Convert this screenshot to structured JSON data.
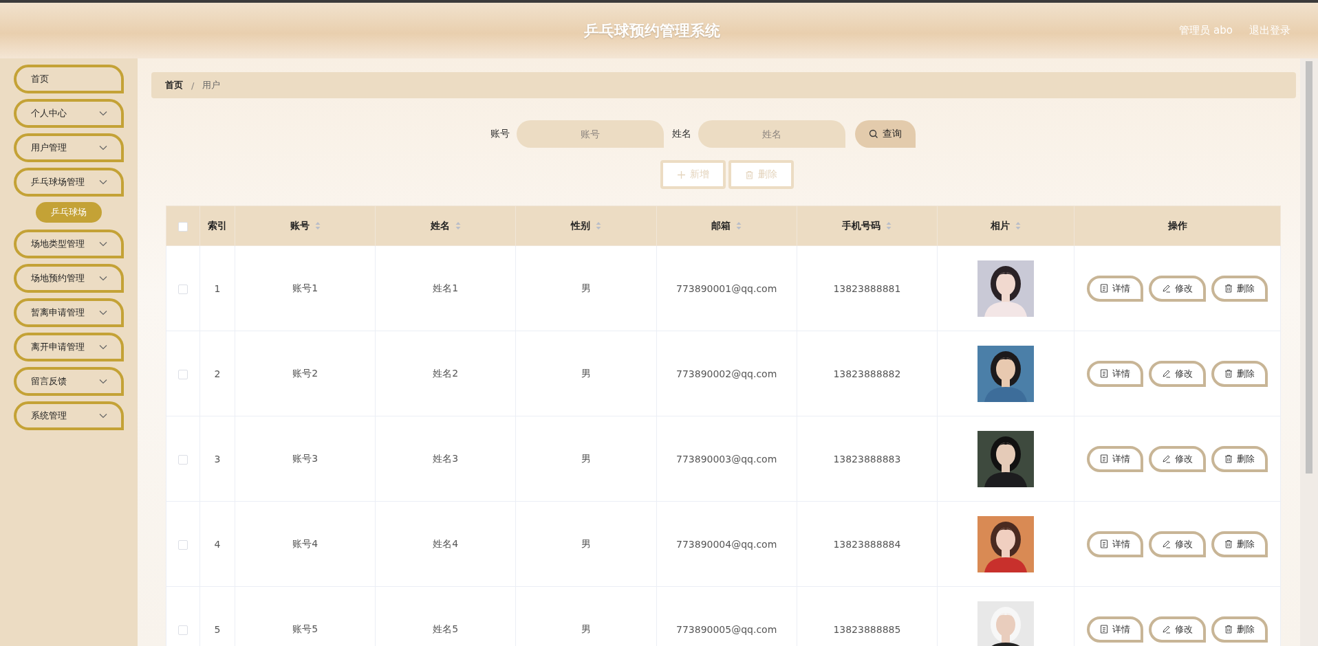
{
  "header": {
    "title": "乒乓球预约管理系统",
    "user": "管理员 abo",
    "logout": "退出登录"
  },
  "sidebar": {
    "items": [
      {
        "label": "首页",
        "kind": "link"
      },
      {
        "label": "个人中心",
        "kind": "submenu"
      },
      {
        "label": "用户管理",
        "kind": "submenu"
      },
      {
        "label": "乒乓球场管理",
        "kind": "submenu",
        "expanded": true,
        "children": [
          {
            "label": "乒乓球场",
            "selected": true
          }
        ]
      },
      {
        "label": "场地类型管理",
        "kind": "submenu"
      },
      {
        "label": "场地预约管理",
        "kind": "submenu"
      },
      {
        "label": "暂离申请管理",
        "kind": "submenu"
      },
      {
        "label": "离开申请管理",
        "kind": "submenu"
      },
      {
        "label": "留言反馈",
        "kind": "submenu"
      },
      {
        "label": "系统管理",
        "kind": "submenu"
      }
    ]
  },
  "breadcrumb": {
    "separator": "/",
    "items": [
      "首页",
      "用户"
    ]
  },
  "search": {
    "fields": [
      {
        "label": "账号",
        "placeholder": "账号"
      },
      {
        "label": "姓名",
        "placeholder": "姓名"
      }
    ],
    "button": "查询"
  },
  "toolbar": [
    {
      "label": "新增",
      "kind": "add",
      "disabled": true
    },
    {
      "label": "删除",
      "kind": "delete",
      "disabled": true
    }
  ],
  "table": {
    "all_checked": false,
    "columns": [
      {
        "label": "索引",
        "sortable": false
      },
      {
        "label": "账号",
        "sortable": true
      },
      {
        "label": "姓名",
        "sortable": true
      },
      {
        "label": "性别",
        "sortable": true
      },
      {
        "label": "邮箱",
        "sortable": true
      },
      {
        "label": "手机号码",
        "sortable": true
      },
      {
        "label": "相片",
        "sortable": true
      },
      {
        "label": "操作",
        "sortable": false
      }
    ],
    "rows": [
      {
        "checked": false,
        "index": "1",
        "account": "账号1",
        "name": "姓名1",
        "gender": "男",
        "email": "773890001@qq.com",
        "phone": "13823888881",
        "actions": [
          "详情",
          "修改",
          "删除"
        ]
      },
      {
        "checked": false,
        "index": "2",
        "account": "账号2",
        "name": "姓名2",
        "gender": "男",
        "email": "773890002@qq.com",
        "phone": "13823888882",
        "actions": [
          "详情",
          "修改",
          "删除"
        ]
      },
      {
        "checked": false,
        "index": "3",
        "account": "账号3",
        "name": "姓名3",
        "gender": "男",
        "email": "773890003@qq.com",
        "phone": "13823888883",
        "actions": [
          "详情",
          "修改",
          "删除"
        ]
      },
      {
        "checked": false,
        "index": "4",
        "account": "账号4",
        "name": "姓名4",
        "gender": "男",
        "email": "773890004@qq.com",
        "phone": "13823888884",
        "actions": [
          "详情",
          "修改",
          "删除"
        ]
      },
      {
        "checked": false,
        "index": "5",
        "account": "账号5",
        "name": "姓名5",
        "gender": "男",
        "email": "773890005@qq.com",
        "phone": "13823888885",
        "actions": [
          "详情",
          "修改",
          "删除"
        ]
      }
    ]
  }
}
